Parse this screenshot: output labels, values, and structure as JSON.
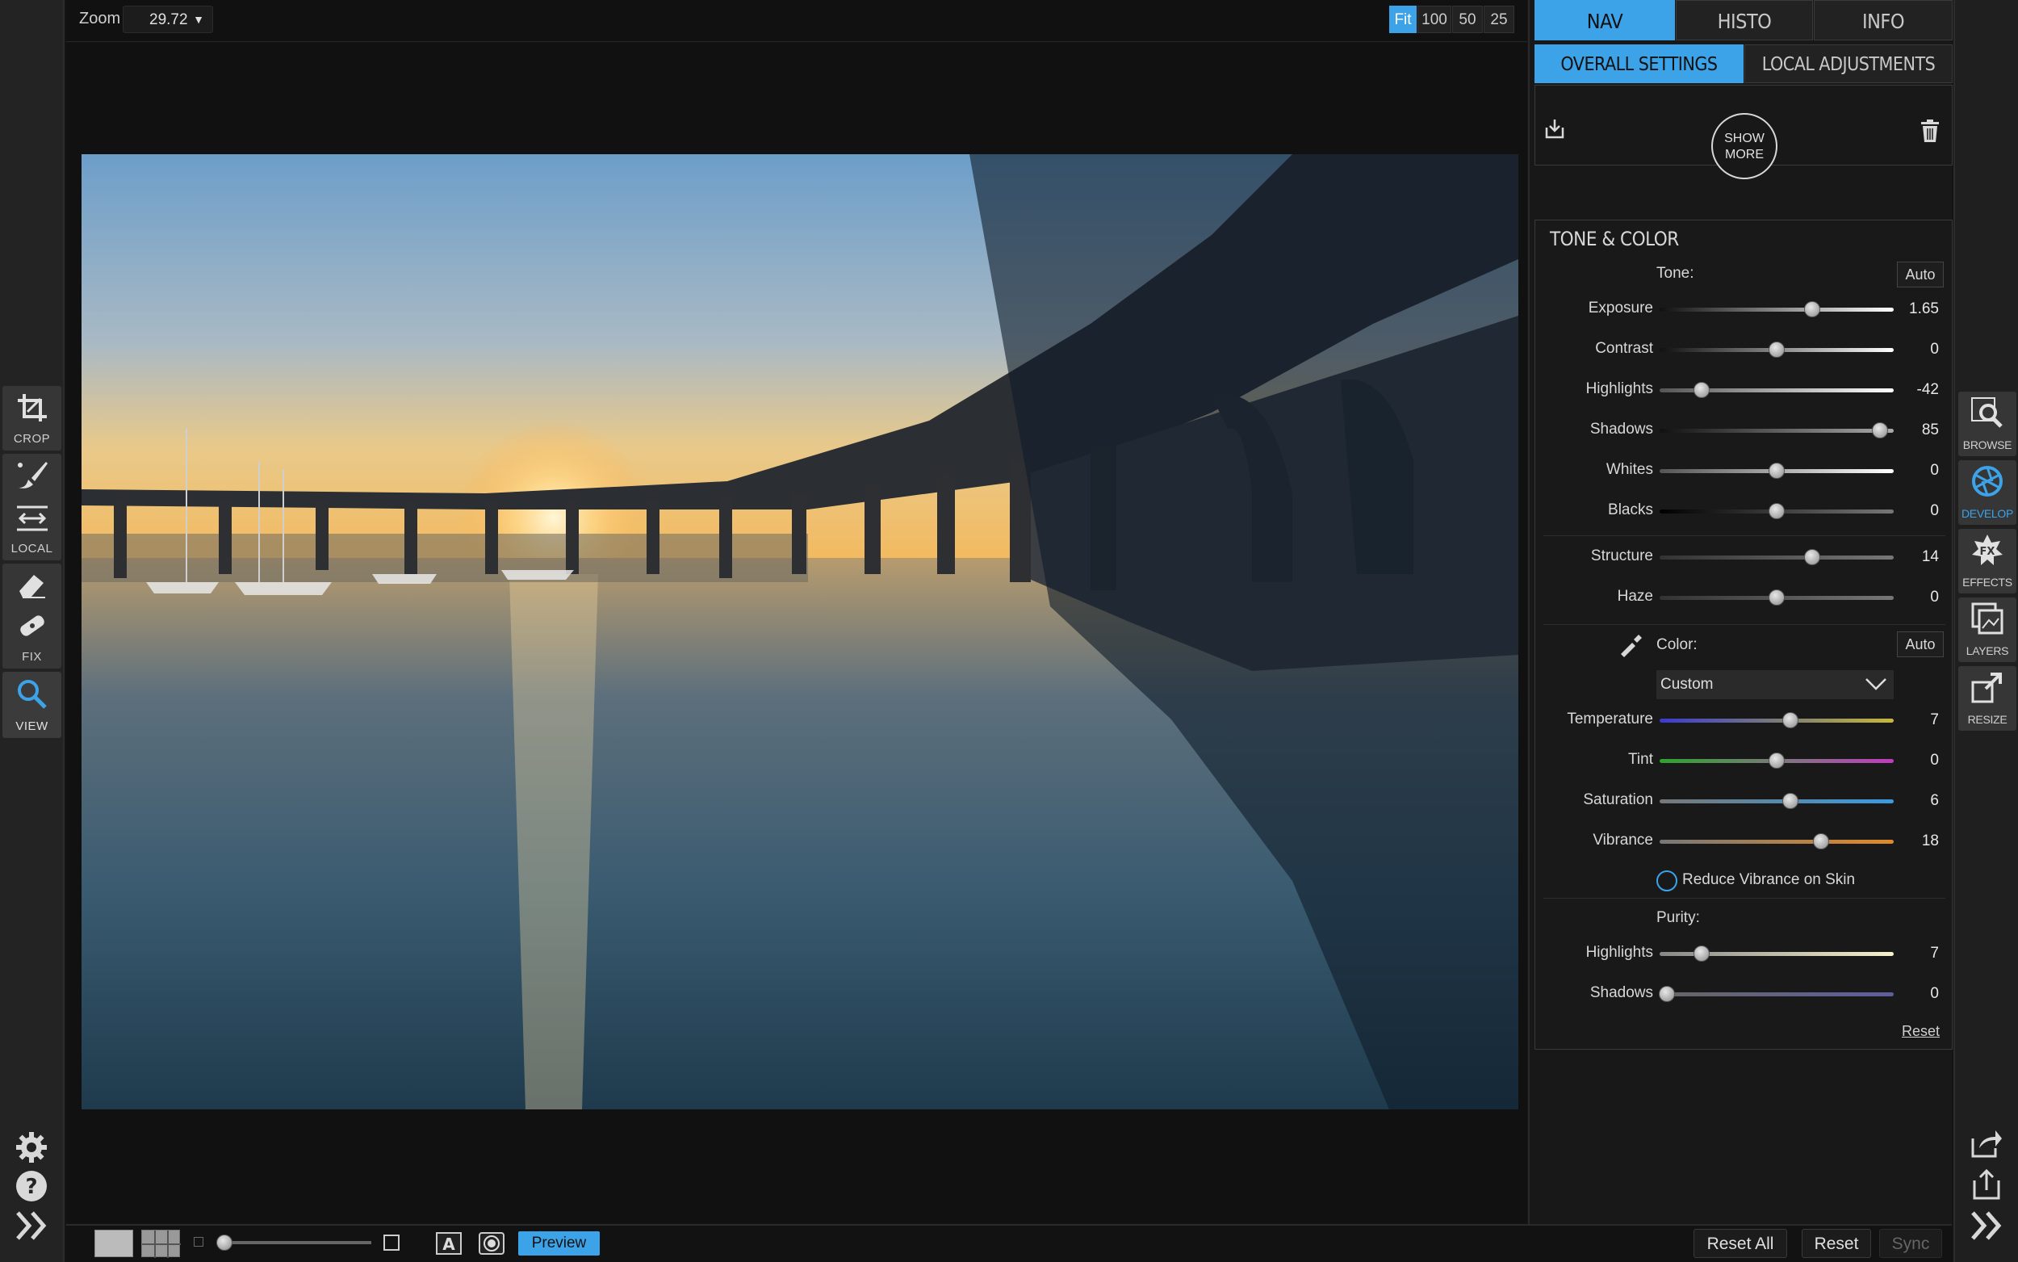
{
  "left_toolbar": {
    "tools": [
      {
        "label": "CROP",
        "icon": "crop-icon"
      },
      {
        "label": "LOCAL",
        "icon": "brush-icon"
      },
      {
        "label": "FIX",
        "icon": "eraser-icon"
      },
      {
        "label": "VIEW",
        "icon": "magnifier-icon"
      }
    ],
    "bottom_icons": [
      "gear-icon",
      "help-icon",
      "expand-left-icon"
    ]
  },
  "topbar": {
    "zoom_label": "Zoom",
    "zoom_value": "29.72",
    "zoom_buttons": [
      "Fit",
      "100",
      "50",
      "25"
    ],
    "active_zoom": "Fit"
  },
  "bottombar": {
    "preview_label": "Preview",
    "reset_all_label": "Reset All",
    "reset_label": "Reset",
    "sync_label": "Sync"
  },
  "right_panel": {
    "tabs": [
      "NAV",
      "HISTO",
      "INFO"
    ],
    "subtabs": [
      "OVERALL SETTINGS",
      "LOCAL ADJUSTMENTS"
    ],
    "show_more": [
      "SHOW",
      "MORE"
    ],
    "section_title": "TONE & COLOR",
    "tone_label": "Tone:",
    "auto_label": "Auto",
    "tone_sliders": [
      {
        "label": "Exposure",
        "value": "1.65",
        "pos": 0.65
      },
      {
        "label": "Contrast",
        "value": "0",
        "pos": 0.5
      },
      {
        "label": "Highlights",
        "value": "-42",
        "pos": 0.18
      },
      {
        "label": "Shadows",
        "value": "85",
        "pos": 0.94
      },
      {
        "label": "Whites",
        "value": "0",
        "pos": 0.5
      },
      {
        "label": "Blacks",
        "value": "0",
        "pos": 0.5
      }
    ],
    "detail_sliders": [
      {
        "label": "Structure",
        "value": "14",
        "pos": 0.65
      },
      {
        "label": "Haze",
        "value": "0",
        "pos": 0.5
      }
    ],
    "color_label": "Color:",
    "color_preset": "Custom",
    "color_sliders": [
      {
        "label": "Temperature",
        "value": "7",
        "pos": 0.56
      },
      {
        "label": "Tint",
        "value": "0",
        "pos": 0.5
      },
      {
        "label": "Saturation",
        "value": "6",
        "pos": 0.56
      },
      {
        "label": "Vibrance",
        "value": "18",
        "pos": 0.69
      }
    ],
    "reduce_vibrance_label": "Reduce Vibrance on Skin",
    "purity_label": "Purity:",
    "purity_sliders": [
      {
        "label": "Highlights",
        "value": "7",
        "pos": 0.18
      },
      {
        "label": "Shadows",
        "value": "0",
        "pos": 0.03
      }
    ],
    "reset_link": "Reset"
  },
  "right_toolbar": {
    "modules": [
      {
        "label": "BROWSE",
        "icon": "browse-icon"
      },
      {
        "label": "DEVELOP",
        "icon": "aperture-icon"
      },
      {
        "label": "EFFECTS",
        "icon": "fx-icon"
      },
      {
        "label": "LAYERS",
        "icon": "layers-icon"
      },
      {
        "label": "RESIZE",
        "icon": "resize-icon"
      }
    ],
    "active": "DEVELOP",
    "bottom_icons": [
      "share-icon",
      "export-icon",
      "expand-right-icon"
    ]
  },
  "colors": {
    "accent": "#3da3e8",
    "panel_bg": "#181818",
    "toolbar_bg": "#232323"
  }
}
